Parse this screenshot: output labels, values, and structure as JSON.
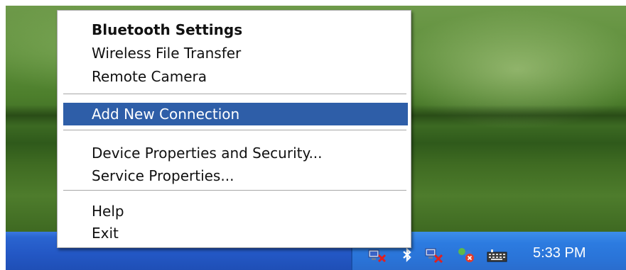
{
  "menu": {
    "groups": [
      {
        "items": [
          {
            "label": "Bluetooth Settings",
            "bold": true
          },
          {
            "label": "Wireless File Transfer"
          },
          {
            "label": "Remote Camera"
          }
        ]
      },
      {
        "items": [
          {
            "label": "Add New Connection",
            "highlighted": true
          }
        ]
      },
      {
        "items": [
          {
            "label": "Device Properties and Security..."
          },
          {
            "label": "Service Properties..."
          }
        ]
      },
      {
        "items": [
          {
            "label": "Help"
          },
          {
            "label": "Exit"
          }
        ]
      }
    ],
    "highlight_color": "#2e5ea8"
  },
  "tray": {
    "icons": [
      "network-disconnected-icon",
      "bluetooth-icon",
      "network-disconnected-icon",
      "network-error-icon",
      "keyboard-icon"
    ],
    "clock": "5:33 PM"
  },
  "colors": {
    "taskbar": "#2357c4",
    "tray": "#2c7be0"
  }
}
